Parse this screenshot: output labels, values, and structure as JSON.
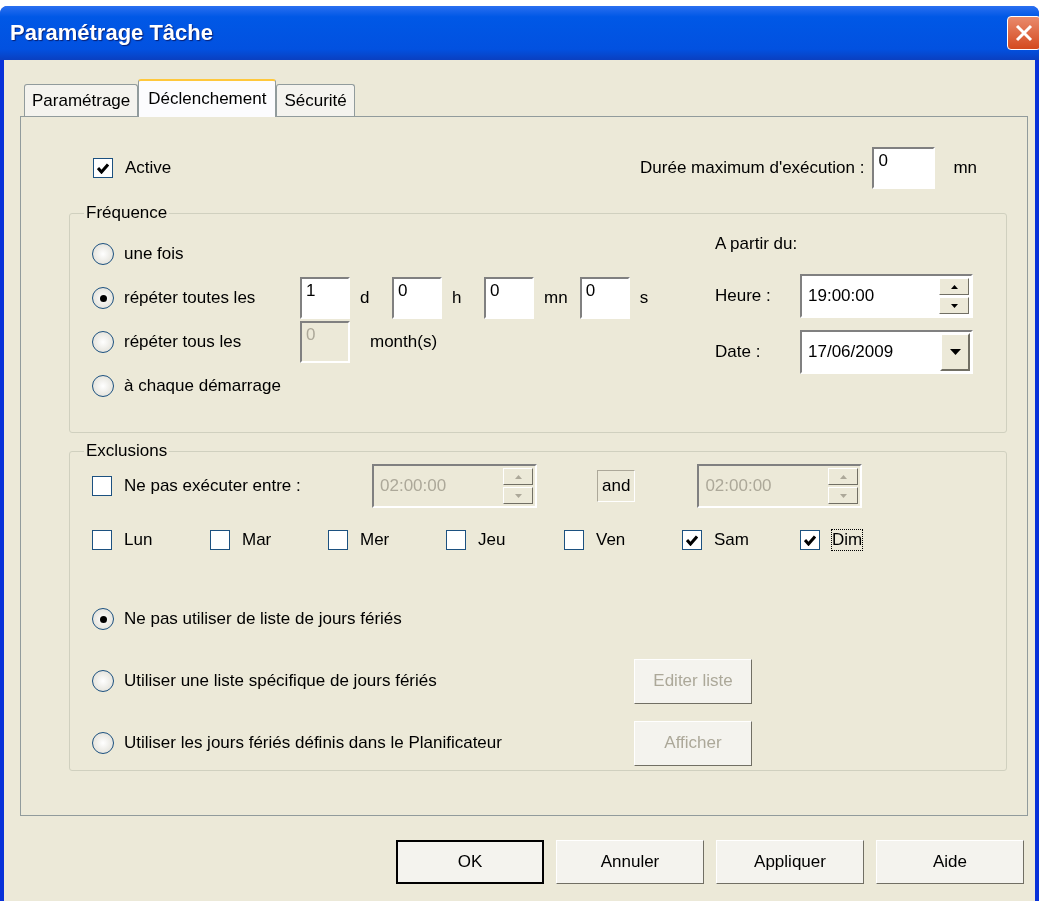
{
  "window": {
    "title": "Paramétrage Tâche"
  },
  "tabs": [
    {
      "label": "Paramétrage",
      "selected": false
    },
    {
      "label": "Déclenchement",
      "selected": true
    },
    {
      "label": "Sécurité",
      "selected": false
    }
  ],
  "active": {
    "label": "Active",
    "checked": true
  },
  "max_duration": {
    "label": "Durée maximum d'exécution :",
    "value": "0",
    "unit": "mn"
  },
  "frequence": {
    "title": "Fréquence",
    "options": [
      {
        "kind": "plain",
        "label": "une fois",
        "selected": false
      },
      {
        "kind": "interval",
        "label": "répéter toutes les",
        "selected": true,
        "fields": [
          {
            "value": "1",
            "unit": "d"
          },
          {
            "value": "0",
            "unit": "h"
          },
          {
            "value": "0",
            "unit": "mn"
          },
          {
            "value": "0",
            "unit": "s"
          }
        ]
      },
      {
        "kind": "monthly",
        "label": "répéter tous les",
        "selected": false,
        "fields": [
          {
            "value": "0",
            "unit": "month(s)",
            "disabled": true
          }
        ]
      },
      {
        "kind": "plain",
        "label": "à chaque démarrage",
        "selected": false
      }
    ],
    "start": {
      "title": "A partir du:",
      "time_label": "Heure :",
      "time": "19:00:00",
      "date_label": "Date :",
      "date": "17/06/2009"
    }
  },
  "exclusions": {
    "title": "Exclusions",
    "between": {
      "label": "Ne pas exécuter entre :",
      "checked": false,
      "from": "02:00:00",
      "and": "and",
      "to": "02:00:00",
      "disabled": true
    },
    "days": [
      {
        "label": "Lun",
        "checked": false,
        "focused": false
      },
      {
        "label": "Mar",
        "checked": false,
        "focused": false
      },
      {
        "label": "Mer",
        "checked": false,
        "focused": false
      },
      {
        "label": "Jeu",
        "checked": false,
        "focused": false
      },
      {
        "label": "Ven",
        "checked": false,
        "focused": false
      },
      {
        "label": "Sam",
        "checked": true,
        "focused": false
      },
      {
        "label": "Dim",
        "checked": true,
        "focused": true
      }
    ],
    "holidays": [
      {
        "label": "Ne pas utiliser de liste de jours fériés",
        "selected": true
      },
      {
        "label": "Utiliser une liste spécifique de jours fériés",
        "selected": false,
        "button": {
          "label": "Editer liste",
          "disabled": true
        }
      },
      {
        "label": "Utiliser les jours fériés définis dans le Planificateur",
        "selected": false,
        "button": {
          "label": "Afficher",
          "disabled": true
        }
      }
    ]
  },
  "buttons": [
    {
      "label": "OK",
      "default": true
    },
    {
      "label": "Annuler",
      "default": false
    },
    {
      "label": "Appliquer",
      "default": false
    },
    {
      "label": "Aide",
      "default": false
    }
  ]
}
